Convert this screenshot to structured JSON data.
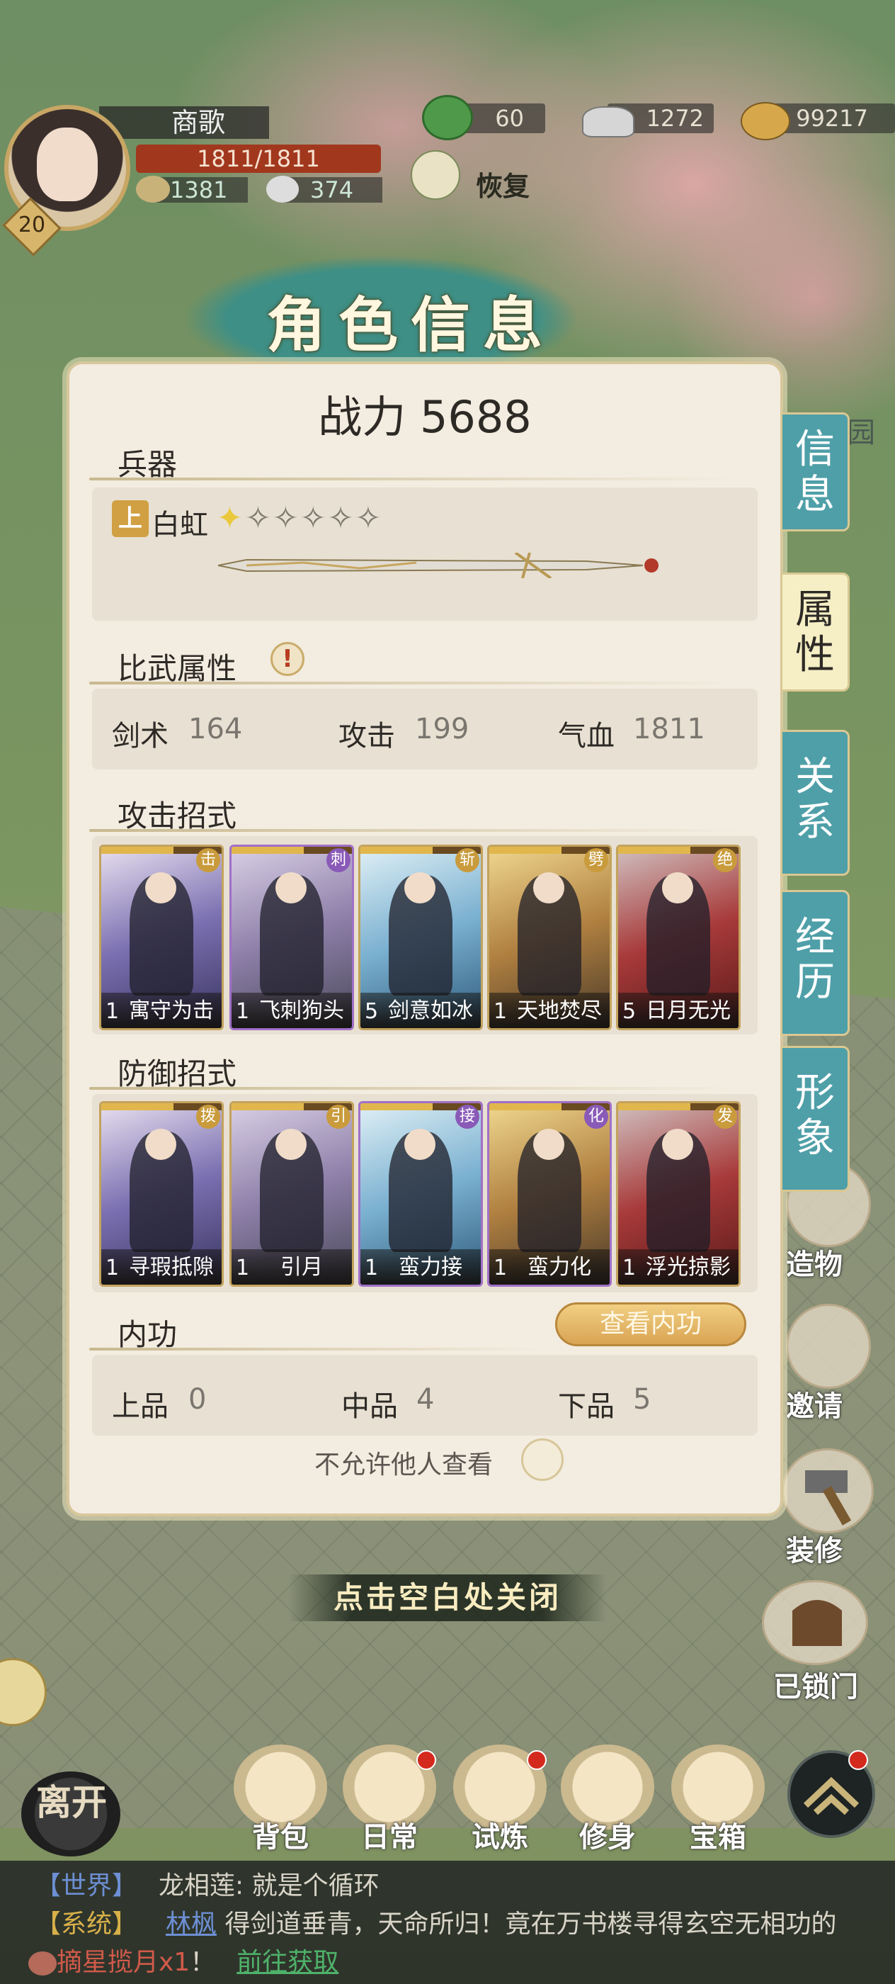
{
  "hud": {
    "player_name": "商歌",
    "level": "20",
    "hp": "1811/1811",
    "stat_tea": "1381",
    "stat_bun": "374",
    "currency_jade": "60",
    "currency_silver": "1272",
    "currency_coin": "99217",
    "restore_label": "恢复"
  },
  "panel": {
    "title": "角色信息",
    "power": "战力 5688",
    "weapon_section": "兵器",
    "weapon_grade": "上",
    "weapon_name": "白虹",
    "weapon_star_lit": "✦",
    "weapon_stars_empty": "✧✧✧✧✧",
    "weapon_stars_rating": 1,
    "weapon_stars_max": 5,
    "combat_section": "比武属性",
    "combat_warn": "!",
    "stats": [
      {
        "label": "剑术",
        "value": "164"
      },
      {
        "label": "攻击",
        "value": "199"
      },
      {
        "label": "气血",
        "value": "1811"
      }
    ],
    "attack_section": "攻击招式",
    "attack_cards": [
      {
        "level": "1",
        "name": "寓守为击",
        "type": "击",
        "frame": "gold"
      },
      {
        "level": "1",
        "name": "飞刺狗头",
        "type": "刺",
        "frame": "purple"
      },
      {
        "level": "5",
        "name": "剑意如冰",
        "type": "斩",
        "frame": "gold"
      },
      {
        "level": "1",
        "name": "天地焚尽",
        "type": "劈",
        "frame": "gold"
      },
      {
        "level": "5",
        "name": "日月无光",
        "type": "绝",
        "frame": "gold"
      }
    ],
    "defense_section": "防御招式",
    "defense_cards": [
      {
        "level": "1",
        "name": "寻瑕抵隙",
        "type": "拨",
        "frame": "gold"
      },
      {
        "level": "1",
        "name": "引月",
        "type": "引",
        "frame": "gold"
      },
      {
        "level": "1",
        "name": "蛮力接",
        "type": "接",
        "frame": "purple"
      },
      {
        "level": "1",
        "name": "蛮力化",
        "type": "化",
        "frame": "purple"
      },
      {
        "level": "1",
        "name": "浮光掠影",
        "type": "发",
        "frame": "gold"
      }
    ],
    "neigong_section": "内功",
    "view_neigong_button": "查看内功",
    "neigong_stats": [
      {
        "label": "上品",
        "value": "0"
      },
      {
        "label": "中品",
        "value": "4"
      },
      {
        "label": "下品",
        "value": "5"
      }
    ],
    "privacy_label": "不允许他人查看"
  },
  "side_tabs": [
    {
      "label": "信息",
      "active": false
    },
    {
      "label": "属性",
      "active": true
    },
    {
      "label": "关系",
      "active": false
    },
    {
      "label": "经历",
      "active": false
    },
    {
      "label": "形象",
      "active": false
    }
  ],
  "close_hint": "点击空白处关闭",
  "right_buttons": {
    "garden": "园",
    "craft": "造物",
    "invite": "邀请",
    "decorate": "装修",
    "locked_door": "已锁门"
  },
  "bottom_nav": [
    {
      "label": "背包",
      "badge": false
    },
    {
      "label": "日常",
      "badge": true
    },
    {
      "label": "试炼",
      "badge": true
    },
    {
      "label": "修身",
      "badge": false
    },
    {
      "label": "宝箱",
      "badge": false
    }
  ],
  "leave_button": "离开",
  "chat": {
    "line1_channel": "【世界】",
    "line1_text": "龙相莲: 就是个循环",
    "line2_channel": "【系统】",
    "line2_name": "林枫",
    "line2_text": "得剑道垂青，天命所归！竟在万书楼寻得玄空无相功的",
    "line3_item": "摘星揽月x1",
    "line3_sep": "！",
    "line3_link": "前往获取"
  },
  "colors": {
    "panel_bg": "#f3ece0",
    "tab_teal": "#4f9fa8",
    "tab_active": "#f6efc6",
    "gold": "#d1a043",
    "hp_red": "#a1381e"
  }
}
